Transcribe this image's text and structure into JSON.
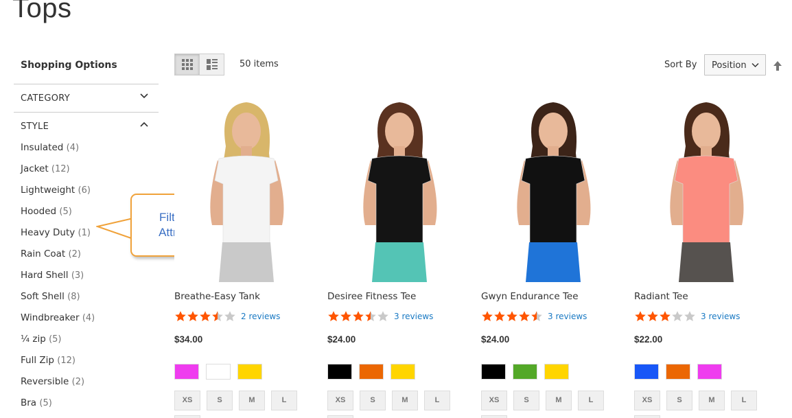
{
  "page": {
    "title": "Tops"
  },
  "sidebar": {
    "title": "Shopping Options",
    "filters": [
      {
        "label": "CATEGORY",
        "expanded": false
      },
      {
        "label": "STYLE",
        "expanded": true
      }
    ],
    "style_options": [
      {
        "label": "Insulated",
        "count": "(4)"
      },
      {
        "label": "Jacket",
        "count": "(12)"
      },
      {
        "label": "Lightweight",
        "count": "(6)"
      },
      {
        "label": "Hooded",
        "count": "(5)"
      },
      {
        "label": "Heavy Duty",
        "count": "(1)"
      },
      {
        "label": "Rain Coat",
        "count": "(2)"
      },
      {
        "label": "Hard Shell",
        "count": "(3)"
      },
      {
        "label": "Soft Shell",
        "count": "(8)"
      },
      {
        "label": "Windbreaker",
        "count": "(4)"
      },
      {
        "label": "¼ zip",
        "count": "(5)"
      },
      {
        "label": "Full Zip",
        "count": "(12)"
      },
      {
        "label": "Reversible",
        "count": "(2)"
      },
      {
        "label": "Bra",
        "count": "(5)"
      }
    ]
  },
  "callout": {
    "line1": "Filterable",
    "line2": "Attributes"
  },
  "toolbar": {
    "view_modes": [
      {
        "name": "grid",
        "icon": "grid-icon",
        "active": true
      },
      {
        "name": "list",
        "icon": "list-icon",
        "active": false
      }
    ],
    "amount": "50 items",
    "sort_label": "Sort By",
    "sort_value": "Position",
    "sort_direction_icon": "arrow-up-icon"
  },
  "products": [
    {
      "name": "Breathe-Easy Tank",
      "rating": 3.5,
      "reviews": "2 reviews",
      "price": "$34.00",
      "colors": [
        "#ef3cef",
        "#ffffff",
        "#ffd500"
      ],
      "sizes": [
        "XS",
        "S",
        "M",
        "L"
      ],
      "shirt_color": "#f4f4f4",
      "bottom_color": "#c9c9c9",
      "hair_color": "#d8b66a"
    },
    {
      "name": "Desiree Fitness Tee",
      "rating": 3.5,
      "reviews": "3 reviews",
      "price": "$24.00",
      "colors": [
        "#000000",
        "#eb6703",
        "#ffd500"
      ],
      "sizes": [
        "XS",
        "S",
        "M",
        "L"
      ],
      "shirt_color": "#141414",
      "bottom_color": "#54c4b5",
      "hair_color": "#5a3220"
    },
    {
      "name": "Gwyn Endurance Tee",
      "rating": 4.5,
      "reviews": "3 reviews",
      "price": "$24.00",
      "colors": [
        "#000000",
        "#53a828",
        "#ffd500"
      ],
      "sizes": [
        "XS",
        "S",
        "M",
        "L"
      ],
      "shirt_color": "#111111",
      "bottom_color": "#1f74d8",
      "hair_color": "#3c2418"
    },
    {
      "name": "Radiant Tee",
      "rating": 3,
      "reviews": "3 reviews",
      "price": "$22.00",
      "colors": [
        "#1857f7",
        "#eb6703",
        "#ef3cef"
      ],
      "sizes": [
        "XS",
        "S",
        "M",
        "L"
      ],
      "shirt_color": "#fb8c80",
      "bottom_color": "#56524f",
      "hair_color": "#4a2a1a"
    }
  ],
  "colors": {
    "star_filled": "#ff5501",
    "star_empty": "#c9c9c9",
    "link": "#1979c3",
    "callout_border": "#f0a23a",
    "callout_text": "#3a6fc4"
  }
}
